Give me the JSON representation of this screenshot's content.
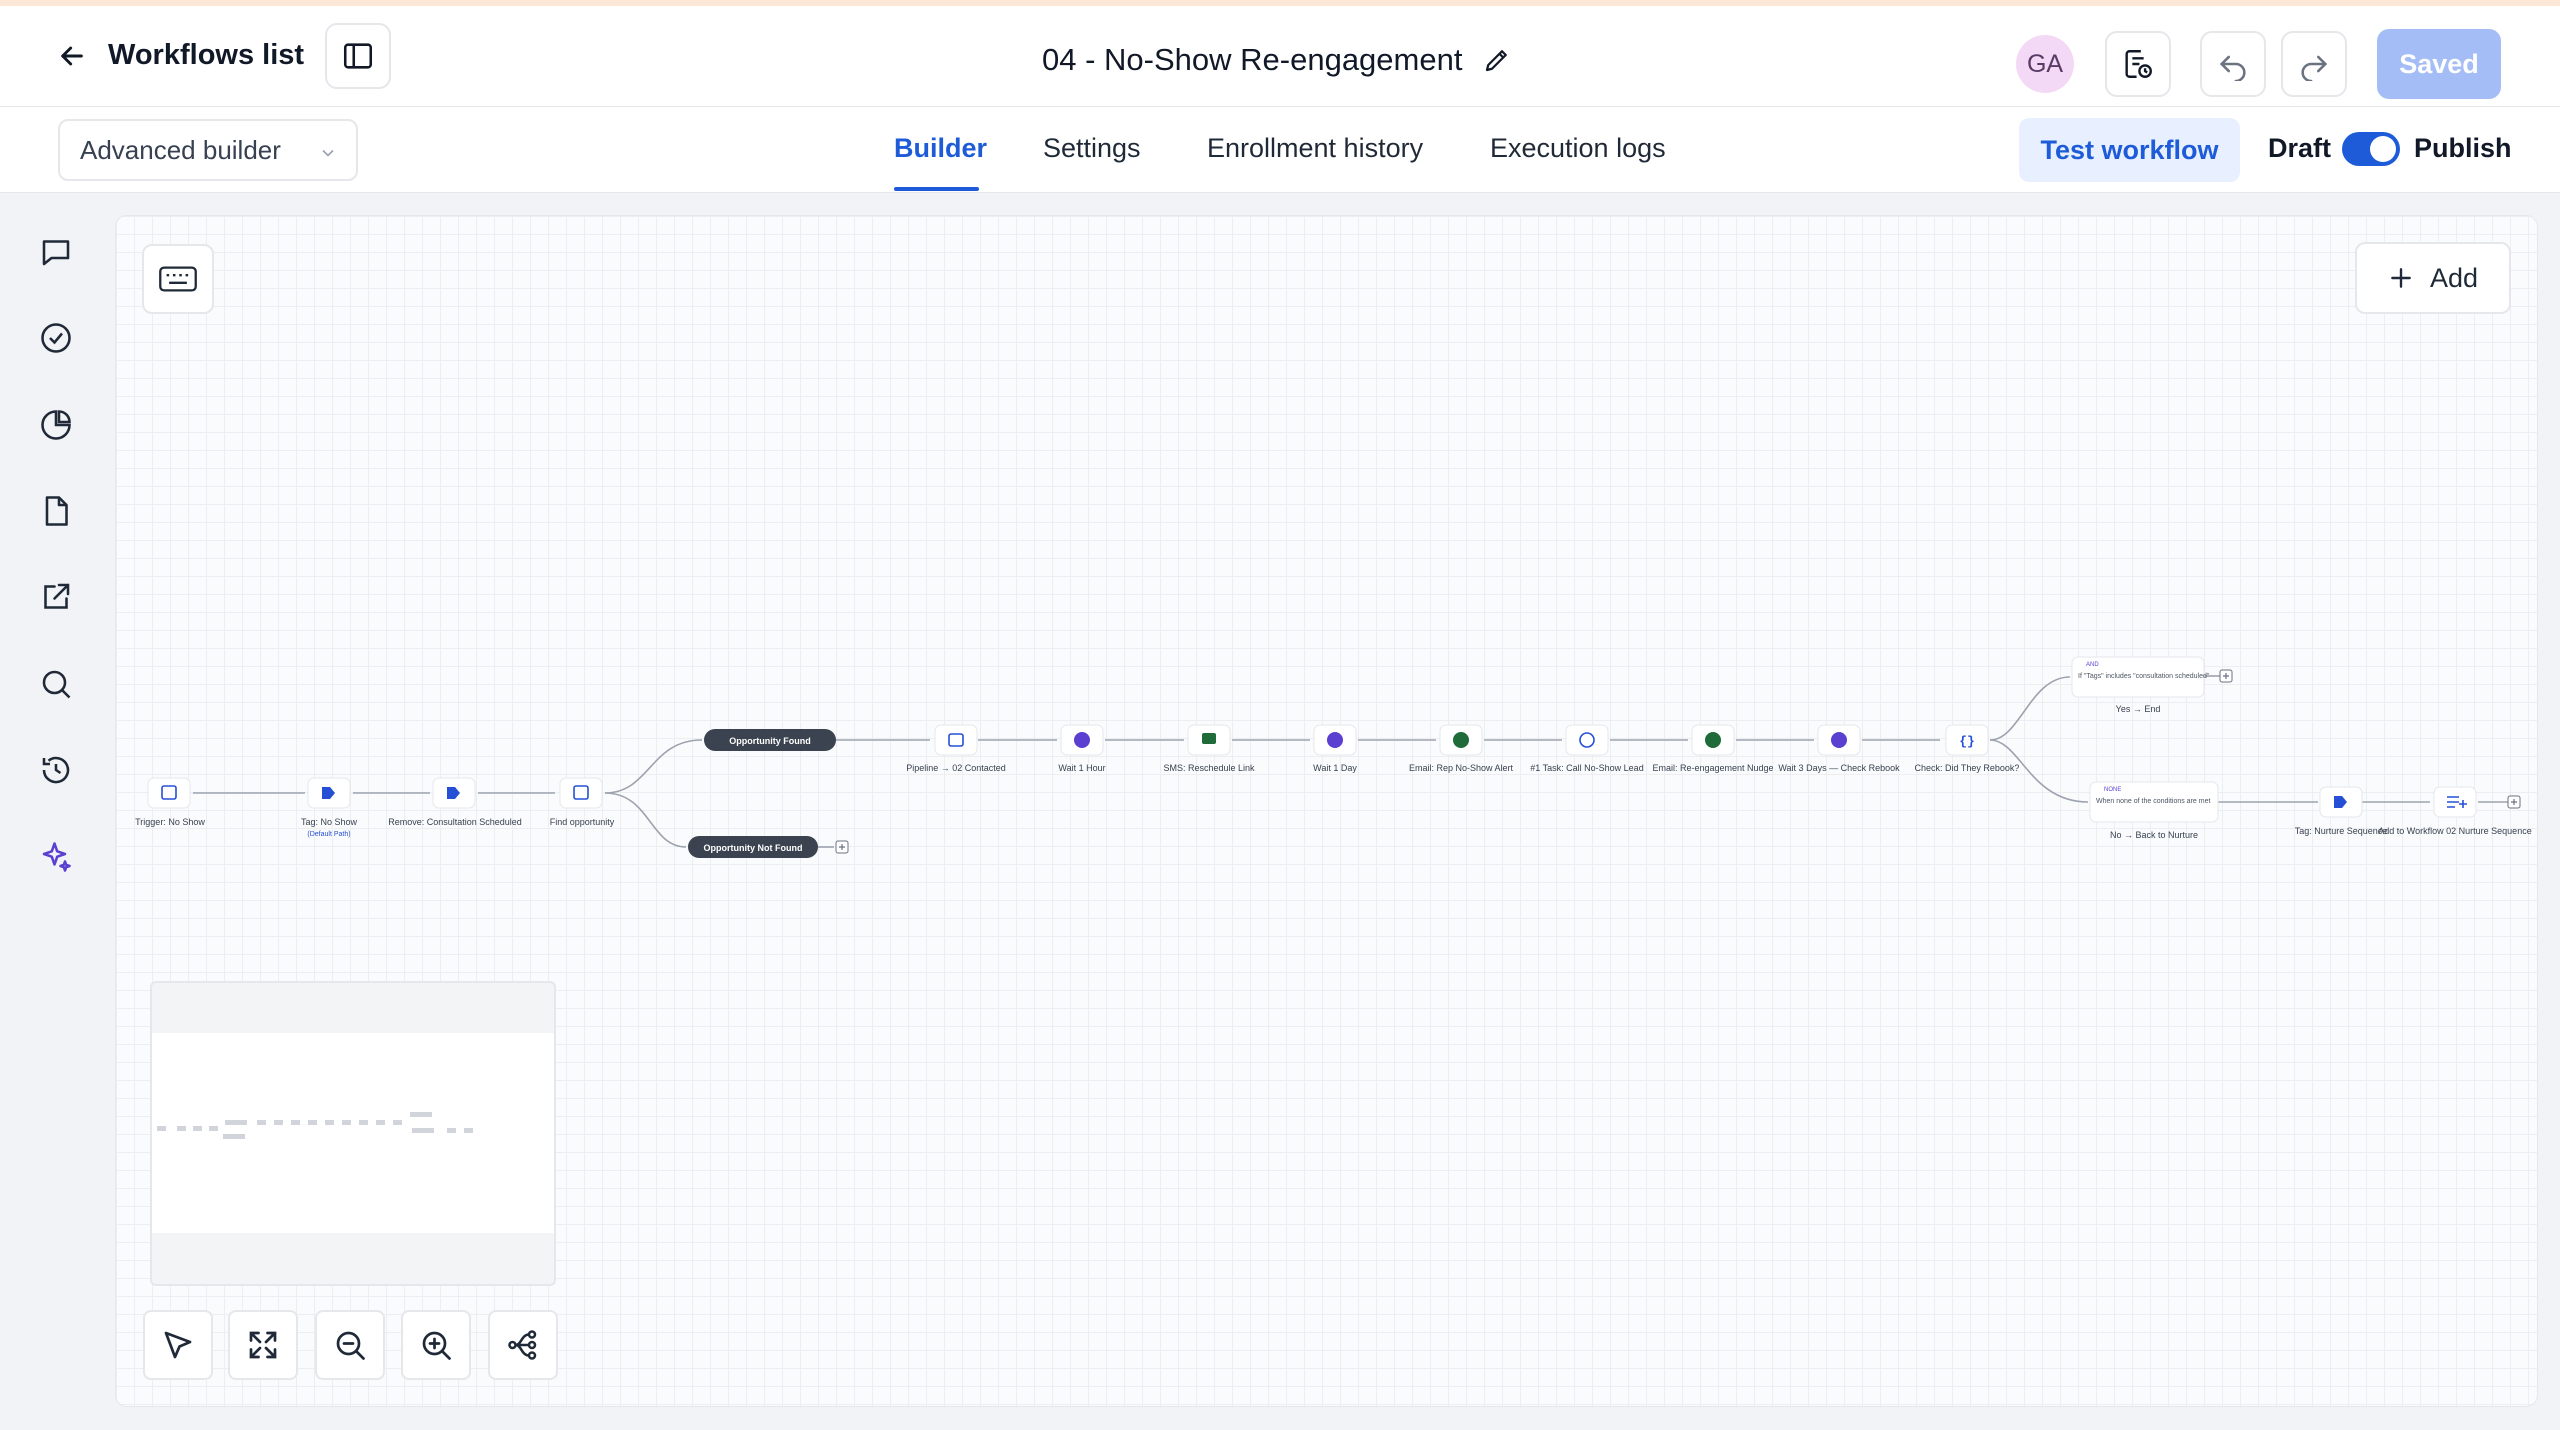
{
  "header": {
    "back_label": "Workflows list",
    "workflow_title": "04 - No-Show Re-engagement",
    "avatar_initials": "GA",
    "saved_label": "Saved"
  },
  "subbar": {
    "builder_mode": "Advanced builder",
    "tabs": [
      {
        "label": "Builder",
        "active": true
      },
      {
        "label": "Settings",
        "active": false
      },
      {
        "label": "Enrollment history",
        "active": false
      },
      {
        "label": "Execution logs",
        "active": false
      }
    ],
    "test_label": "Test workflow",
    "draft_label": "Draft",
    "publish_label": "Publish",
    "publish_toggle_on": true
  },
  "rail": {
    "icons": [
      "chat-icon",
      "check-circle-icon",
      "pie-chart-icon",
      "file-icon",
      "external-link-icon",
      "search-icon",
      "history-icon",
      "sparkle-icon"
    ]
  },
  "canvas": {
    "add_label": "Add",
    "nodes": {
      "trigger": "Trigger: No Show",
      "tag_no_show": "Tag: No Show",
      "tag_no_show_sub": "(Default Path)",
      "remove_tag": "Remove: Consultation Scheduled",
      "find_opp": "Find opportunity",
      "opp_found": "Opportunity Found",
      "opp_not_found": "Opportunity Not Found",
      "pipeline": "Pipeline → 02 Contacted",
      "wait1h": "Wait 1 Hour",
      "sms": "SMS: Reschedule Link",
      "wait1d": "Wait 1 Day",
      "email_rep": "Email: Rep No-Show Alert",
      "task": "#1 Task: Call No-Show Lead",
      "email_nudge": "Email: Re-engagement Nudge",
      "wait3d": "Wait 3 Days — Check Rebook",
      "check": "Check: Did They Rebook?",
      "yes_tag": "AND",
      "yes_text": "If \"Tags\" includes \"consultation scheduled\"",
      "yes_label": "Yes → End",
      "no_tag": "NONE",
      "no_text": "When none of the conditions are met",
      "no_label": "No → Back to Nurture",
      "tag_nurture": "Tag: Nurture Sequence",
      "add_workflow": "Add to Workflow 02 Nurture Sequence"
    }
  },
  "colors": {
    "accent": "#1d5bd8",
    "dark_pill": "#3b4350",
    "wait_purple": "#5b3fd1",
    "email_green": "#1f6b3a",
    "tag_blue": "#2550d6"
  }
}
